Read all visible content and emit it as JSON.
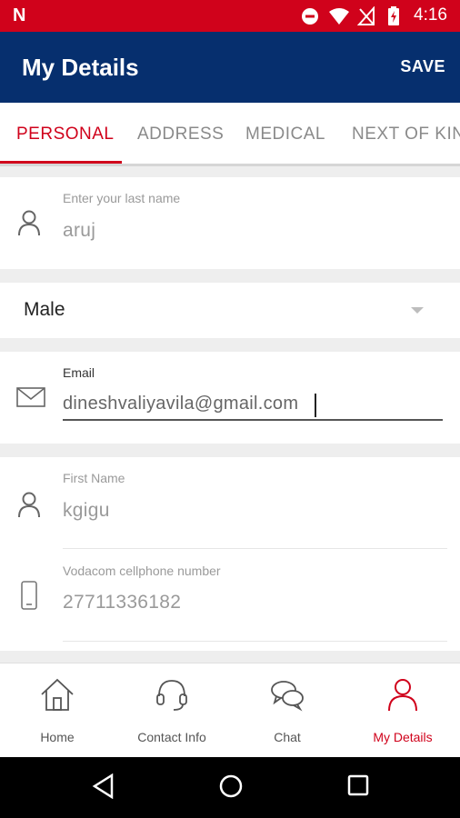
{
  "status_bar": {
    "carrier_logo": "N",
    "time": "4:16"
  },
  "app_bar": {
    "title": "My Details",
    "save_label": "SAVE"
  },
  "tabs": [
    {
      "label": "PERSONAL"
    },
    {
      "label": "ADDRESS"
    },
    {
      "label": "MEDICAL"
    },
    {
      "label": "NEXT OF KIN"
    }
  ],
  "form": {
    "last_name": {
      "placeholder": "Enter your last name",
      "value": "aruj"
    },
    "gender": {
      "value": "Male"
    },
    "email": {
      "label": "Email",
      "value": "dineshvaliyavila@gmail.com"
    },
    "first_name": {
      "label": "First Name",
      "value": "kgigu"
    },
    "cellphone": {
      "label": "Vodacom cellphone number",
      "value": "27711336182"
    }
  },
  "bottom_nav": [
    {
      "label": "Home"
    },
    {
      "label": "Contact Info"
    },
    {
      "label": "Chat"
    },
    {
      "label": "My Details"
    }
  ],
  "colors": {
    "brand_red": "#d0021b",
    "navy": "#062f6e"
  }
}
